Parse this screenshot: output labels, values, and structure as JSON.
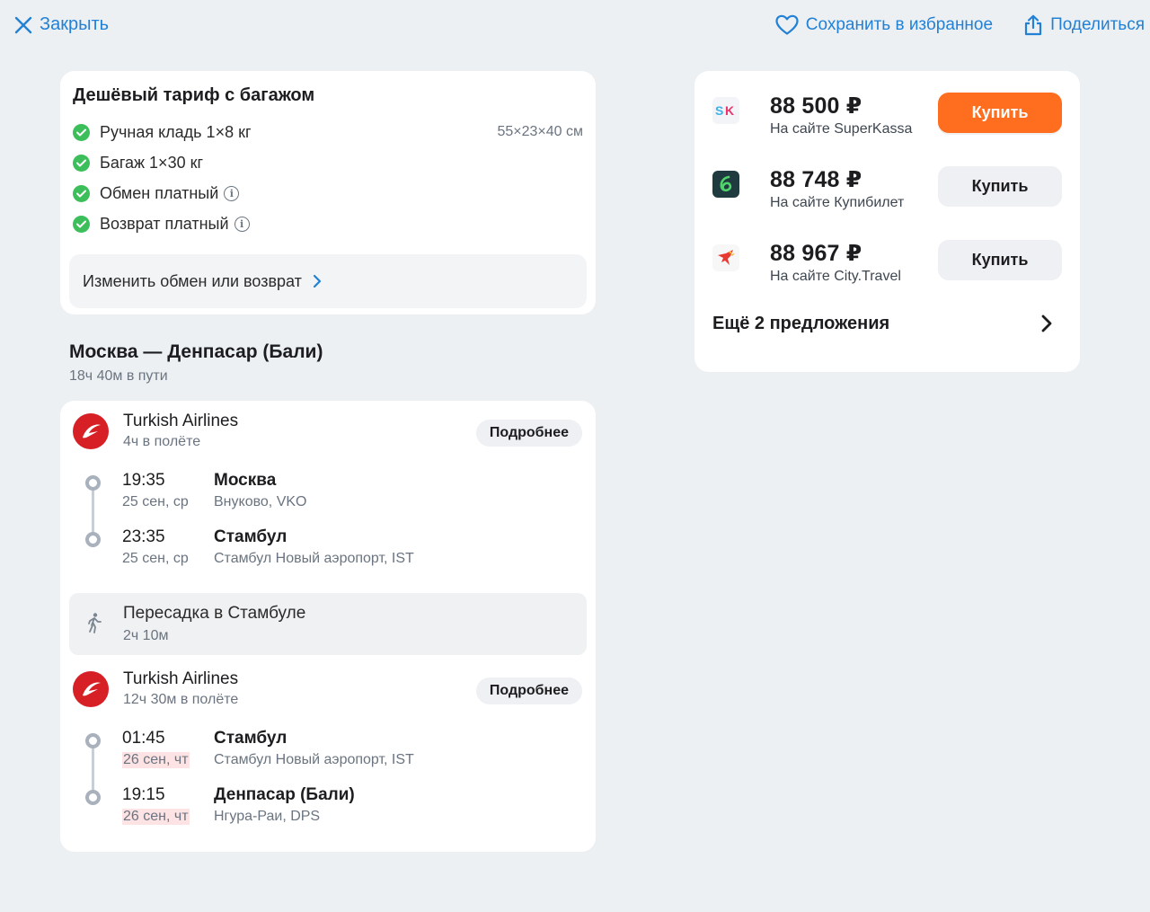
{
  "header": {
    "close_label": "Закрыть",
    "save_label": "Сохранить в избранное",
    "share_label": "Поделиться"
  },
  "tariff": {
    "title": "Дешёвый тариф с багажом",
    "features": [
      {
        "label": "Ручная кладь 1×8 кг",
        "spec": "55×23×40 см",
        "info": false
      },
      {
        "label": "Багаж 1×30 кг",
        "spec": "",
        "info": false
      },
      {
        "label": "Обмен платный",
        "spec": "",
        "info": true
      },
      {
        "label": "Возврат платный",
        "spec": "",
        "info": true
      }
    ],
    "change_label": "Изменить обмен или возврат"
  },
  "route": {
    "title": "Москва — Денпасар (Бали)",
    "duration": "18ч 40м в пути"
  },
  "segments": [
    {
      "airline": "Turkish Airlines",
      "flight_time": "4ч в полёте",
      "more_label": "Подробнее",
      "departure": {
        "time": "19:35",
        "date": "25 сен, ср",
        "city": "Москва",
        "airport": "Внуково, VKO"
      },
      "arrival": {
        "time": "23:35",
        "date": "25 сен, ср",
        "city": "Стамбул",
        "airport": "Стамбул Новый аэропорт, IST"
      }
    },
    {
      "airline": "Turkish Airlines",
      "flight_time": "12ч 30м в полёте",
      "more_label": "Подробнее",
      "departure": {
        "time": "01:45",
        "date": "26 сен, чт",
        "city": "Стамбул",
        "airport": "Стамбул Новый аэропорт, IST"
      },
      "arrival": {
        "time": "19:15",
        "date": "26 сен, чт",
        "city": "Денпасар (Бали)",
        "airport": "Нгура-Раи, DPS"
      }
    }
  ],
  "transfer": {
    "title": "Пересадка в Стамбуле",
    "duration": "2ч 10м"
  },
  "offers": [
    {
      "price": "88 500 ₽",
      "site": "На сайте SuperKassa",
      "buy_label": "Купить",
      "primary": true,
      "logo": "superkassa-logo"
    },
    {
      "price": "88 748 ₽",
      "site": "На сайте Купибилет",
      "buy_label": "Купить",
      "primary": false,
      "logo": "kupibilet-logo"
    },
    {
      "price": "88 967 ₽",
      "site": "На сайте City.Travel",
      "buy_label": "Купить",
      "primary": false,
      "logo": "citytravel-logo"
    }
  ],
  "more_offers_label": "Ещё 2 предложения",
  "colors": {
    "accent": "#2281d5",
    "buy_primary": "#ff6d1e",
    "check": "#3cbe5b",
    "airline": "#d71f26"
  }
}
